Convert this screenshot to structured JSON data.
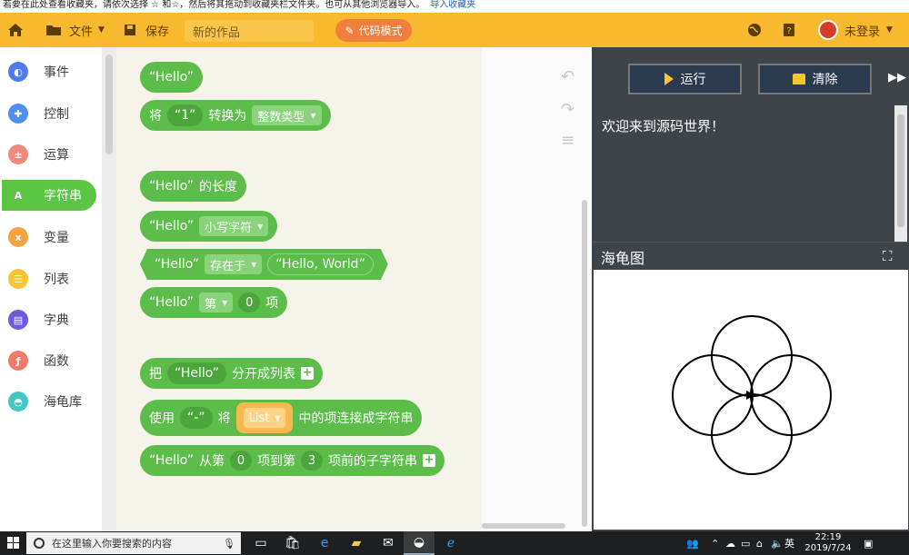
{
  "infobar": {
    "text": "若要在此处查看收藏夹，请依次选择 ☆ 和☆，然后将其拖动到收藏夹栏文件夹。也可从其他浏览器导入。",
    "link": "导入收藏夹"
  },
  "header": {
    "file_label": "文件",
    "save_label": "保存",
    "project_name": "新的作品",
    "code_mode_label": "代码模式",
    "user_label": "未登录"
  },
  "sidebar": {
    "items": [
      {
        "label": "事件",
        "color": "#4e7bf0",
        "icon": "toggle-icon"
      },
      {
        "label": "控制",
        "color": "#4e8ff0",
        "icon": "gamepad-icon"
      },
      {
        "label": "运算",
        "color": "#f3897d",
        "icon": "calculator-icon"
      },
      {
        "label": "字符串",
        "color": "#5ac643",
        "icon": "string-icon"
      },
      {
        "label": "变量",
        "color": "#f7a23a",
        "icon": "variable-icon"
      },
      {
        "label": "列表",
        "color": "#f7c531",
        "icon": "list-icon"
      },
      {
        "label": "字典",
        "color": "#6b5bd8",
        "icon": "book-icon"
      },
      {
        "label": "函数",
        "color": "#f07b6a",
        "icon": "function-icon"
      },
      {
        "label": "海龟库",
        "color": "#3fc9c0",
        "icon": "turtle-icon"
      }
    ]
  },
  "blocks": {
    "hello": "“Hello”",
    "b2_prefix": "将",
    "b2_value": "“1”",
    "b2_mid": "转换为",
    "b2_dropdown": "整数类型",
    "b3_suffix": "的长度",
    "b4_dropdown": "小写字符",
    "b5_dropdown": "存在于",
    "b5_value": "“Hello, World”",
    "b6_dropdown": "第",
    "b6_num": "0",
    "b6_suffix": "项",
    "b7_prefix": "把",
    "b7_suffix": "分开成列表",
    "b8_prefix": "使用",
    "b8_sep": "“-”",
    "b8_mid": "将",
    "b8_list": "List",
    "b8_suffix": "中的项连接成字符串",
    "b9_mid1": "从第",
    "b9_num1": "0",
    "b9_mid2": "项到第",
    "b9_num2": "3",
    "b9_suffix": "项前的子字符串"
  },
  "right_panel": {
    "run_label": "运行",
    "clear_label": "清除",
    "console_output": "欢迎来到源码世界！",
    "turtle_title": "海龟图"
  },
  "taskbar": {
    "search_placeholder": "在这里输入你要搜索的内容",
    "ime": "英",
    "time": "22:19",
    "date": "2019/7/24"
  }
}
